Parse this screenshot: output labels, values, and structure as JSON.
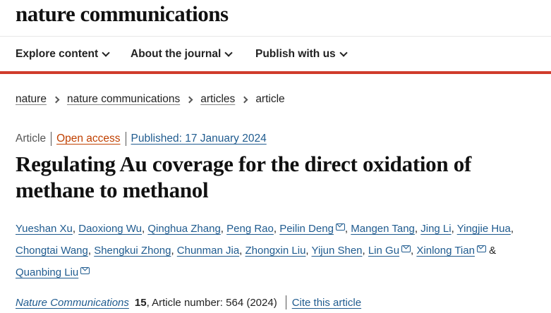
{
  "header": {
    "logo": "nature communications"
  },
  "nav": {
    "items": [
      {
        "label": "Explore content"
      },
      {
        "label": "About the journal"
      },
      {
        "label": "Publish with us"
      }
    ]
  },
  "breadcrumb": {
    "items": [
      "nature",
      "nature communications",
      "articles"
    ],
    "current": "article"
  },
  "meta": {
    "type": "Article",
    "access": "Open access",
    "published": "Published: 17 January 2024"
  },
  "title": "Regulating Au coverage for the direct oxidation of methane to methanol",
  "authors": [
    {
      "name": "Yueshan Xu",
      "email": false
    },
    {
      "name": "Daoxiong Wu",
      "email": false
    },
    {
      "name": "Qinghua Zhang",
      "email": false
    },
    {
      "name": "Peng Rao",
      "email": false
    },
    {
      "name": "Peilin Deng",
      "email": true
    },
    {
      "name": "Mangen Tang",
      "email": false
    },
    {
      "name": "Jing Li",
      "email": false
    },
    {
      "name": "Yingjie Hua",
      "email": false
    },
    {
      "name": "Chongtai Wang",
      "email": false
    },
    {
      "name": "Shengkui Zhong",
      "email": false
    },
    {
      "name": "Chunman Jia",
      "email": false
    },
    {
      "name": "Zhongxin Liu",
      "email": false
    },
    {
      "name": "Yijun Shen",
      "email": false
    },
    {
      "name": "Lin Gu",
      "email": true
    },
    {
      "name": "Xinlong Tian",
      "email": true
    },
    {
      "name": "Quanbing Liu",
      "email": true
    }
  ],
  "authors_conjunction": "&",
  "citation": {
    "journal": "Nature Communications",
    "volume": "15",
    "article": ", Article number: 564 (2024)",
    "cite_label": "Cite this article"
  },
  "colors": {
    "accent_bar": "#d03b2b",
    "link": "#1f5b8f",
    "open_access": "#c04000"
  }
}
